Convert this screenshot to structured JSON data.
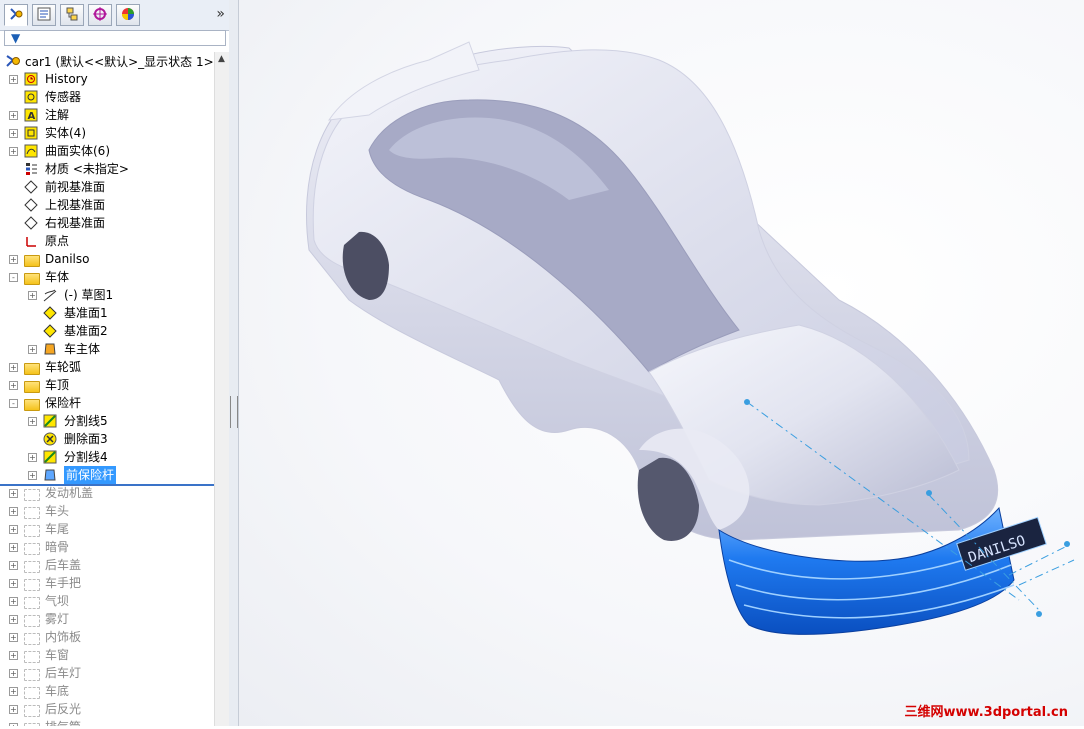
{
  "tree": {
    "root_label": "car1  (默认<<默认>_显示状态 1>)",
    "items": [
      {
        "label": "History",
        "icon": "history-icon",
        "level": 1,
        "exp": "+",
        "state": "normal"
      },
      {
        "label": "传感器",
        "icon": "sensor-icon",
        "level": 1,
        "exp": "",
        "state": "normal"
      },
      {
        "label": "注解",
        "icon": "annotation-icon",
        "level": 1,
        "exp": "+",
        "state": "normal"
      },
      {
        "label": "实体(4)",
        "icon": "solid-body-icon",
        "level": 1,
        "exp": "+",
        "state": "normal"
      },
      {
        "label": "曲面实体(6)",
        "icon": "surface-body-icon",
        "level": 1,
        "exp": "+",
        "state": "normal"
      },
      {
        "label": "材质 <未指定>",
        "icon": "material-icon",
        "level": 1,
        "exp": "",
        "state": "normal"
      },
      {
        "label": "前视基准面",
        "icon": "plane-icon",
        "level": 1,
        "exp": "",
        "state": "normal"
      },
      {
        "label": "上视基准面",
        "icon": "plane-icon",
        "level": 1,
        "exp": "",
        "state": "normal"
      },
      {
        "label": "右视基准面",
        "icon": "plane-icon",
        "level": 1,
        "exp": "",
        "state": "normal"
      },
      {
        "label": "原点",
        "icon": "origin-icon",
        "level": 1,
        "exp": "",
        "state": "normal"
      },
      {
        "label": "Danilso",
        "icon": "folder-icon",
        "level": 1,
        "exp": "+",
        "state": "normal"
      },
      {
        "label": "车体",
        "icon": "folder-icon",
        "level": 1,
        "exp": "-",
        "state": "normal"
      },
      {
        "label": "(-) 草图1",
        "icon": "sketch-icon",
        "level": 2,
        "exp": "+",
        "state": "normal"
      },
      {
        "label": "基准面1",
        "icon": "ref-plane-icon",
        "level": 2,
        "exp": "",
        "state": "normal"
      },
      {
        "label": "基准面2",
        "icon": "ref-plane-icon",
        "level": 2,
        "exp": "",
        "state": "normal"
      },
      {
        "label": "车主体",
        "icon": "loft-icon",
        "level": 2,
        "exp": "+",
        "state": "normal"
      },
      {
        "label": "车轮弧",
        "icon": "folder-icon",
        "level": 1,
        "exp": "+",
        "state": "normal"
      },
      {
        "label": "车顶",
        "icon": "folder-icon",
        "level": 1,
        "exp": "+",
        "state": "normal"
      },
      {
        "label": "保险杆",
        "icon": "folder-icon",
        "level": 1,
        "exp": "-",
        "state": "normal"
      },
      {
        "label": "分割线5",
        "icon": "split-line-icon",
        "level": 2,
        "exp": "+",
        "state": "normal"
      },
      {
        "label": "删除面3",
        "icon": "delete-face-icon",
        "level": 2,
        "exp": "",
        "state": "normal"
      },
      {
        "label": "分割线4",
        "icon": "split-line-icon",
        "level": 2,
        "exp": "+",
        "state": "normal"
      },
      {
        "label": "前保险杆",
        "icon": "boundary-surface-icon",
        "level": 2,
        "exp": "+",
        "state": "selected"
      },
      {
        "label": "发动机盖",
        "icon": "folder-icon",
        "level": 1,
        "exp": "+",
        "state": "disabled"
      },
      {
        "label": "车头",
        "icon": "folder-icon",
        "level": 1,
        "exp": "+",
        "state": "disabled"
      },
      {
        "label": "车尾",
        "icon": "folder-icon",
        "level": 1,
        "exp": "+",
        "state": "disabled"
      },
      {
        "label": "暗骨",
        "icon": "folder-icon",
        "level": 1,
        "exp": "+",
        "state": "disabled"
      },
      {
        "label": "后车盖",
        "icon": "folder-icon",
        "level": 1,
        "exp": "+",
        "state": "disabled"
      },
      {
        "label": "车手把",
        "icon": "folder-icon",
        "level": 1,
        "exp": "+",
        "state": "disabled"
      },
      {
        "label": "气坝",
        "icon": "folder-icon",
        "level": 1,
        "exp": "+",
        "state": "disabled"
      },
      {
        "label": "雾灯",
        "icon": "folder-icon",
        "level": 1,
        "exp": "+",
        "state": "disabled"
      },
      {
        "label": "内饰板",
        "icon": "folder-icon",
        "level": 1,
        "exp": "+",
        "state": "disabled"
      },
      {
        "label": "车窗",
        "icon": "folder-icon",
        "level": 1,
        "exp": "+",
        "state": "disabled"
      },
      {
        "label": "后车灯",
        "icon": "folder-icon",
        "level": 1,
        "exp": "+",
        "state": "disabled"
      },
      {
        "label": "车底",
        "icon": "folder-icon",
        "level": 1,
        "exp": "+",
        "state": "disabled"
      },
      {
        "label": "后反光",
        "icon": "folder-icon",
        "level": 1,
        "exp": "+",
        "state": "disabled"
      },
      {
        "label": "排气筒",
        "icon": "folder-icon",
        "level": 1,
        "exp": "+",
        "state": "disabled"
      }
    ]
  },
  "tabs": [
    {
      "name": "featuremanager-tab",
      "icon": "feature-tree-icon"
    },
    {
      "name": "propertymanager-tab",
      "icon": "property-icon"
    },
    {
      "name": "configurationmanager-tab",
      "icon": "configuration-icon"
    },
    {
      "name": "dimxpert-tab",
      "icon": "dimxpert-icon"
    },
    {
      "name": "display-manager-tab",
      "icon": "appearance-icon"
    }
  ],
  "tab_more": "»",
  "filter_icon": "▼",
  "plate_text": "DANILSO",
  "watermark": "三维网www.3dportal.cn",
  "colors": {
    "selection": "#3399ff",
    "bumper": "#1a6fe8",
    "body": "#dfe1ee",
    "watermark": "#d40000"
  }
}
